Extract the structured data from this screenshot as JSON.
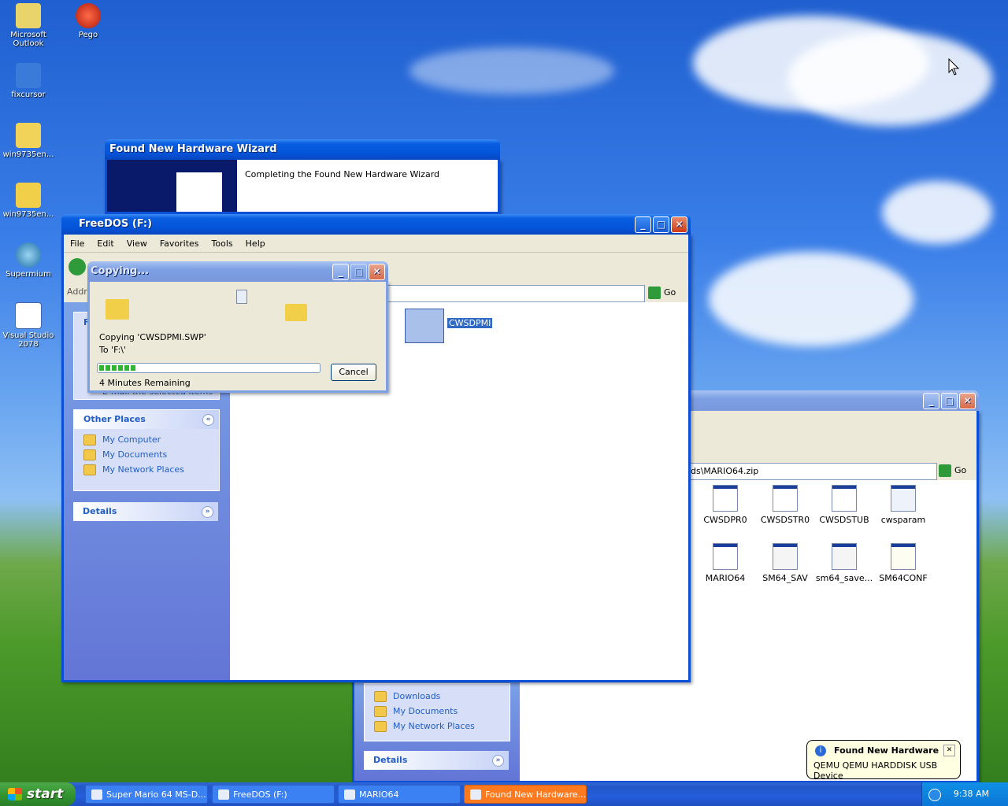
{
  "desktop": {
    "icons": [
      {
        "label": "Microsoft Outlook"
      },
      {
        "label": "Pego"
      },
      {
        "label": "fixcursor"
      },
      {
        "label": "win9735en..."
      },
      {
        "label": "win9735en..."
      },
      {
        "label": "Supermium"
      },
      {
        "label": "Visual Studio 2078"
      }
    ]
  },
  "wizard": {
    "title": "Found New Hardware Wizard",
    "heading": "Completing the Found New Hardware Wizard"
  },
  "freedos": {
    "title": "FreeDOS (F:)",
    "menu": [
      "File",
      "Edit",
      "View",
      "Favorites",
      "Tools",
      "Help"
    ],
    "address_label": "Addr",
    "go_label": "Go",
    "selected_file": "CWSDPMI",
    "hidden_task_text": "E-mail the selected items",
    "panel_task_label": "F",
    "other_places": {
      "title": "Other Places",
      "items": [
        "My Computer",
        "My Documents",
        "My Network Places"
      ]
    },
    "details_title": "Details"
  },
  "copying": {
    "title": "Copying...",
    "line1": "Copying 'CWSDPMI.SWP'",
    "line2": "To 'F:\\'",
    "remaining": "4 Minutes Remaining",
    "cancel_label": "Cancel",
    "progress": 0.17
  },
  "mario": {
    "address": "ds\\MARIO64.zip",
    "go_label": "Go",
    "files": [
      "CWSDPR0",
      "CWSDSTR0",
      "CWSDSTUB",
      "cwsparam",
      "MARIO64",
      "SM64_SAV",
      "sm64_save...",
      "SM64CONF"
    ],
    "other_places": [
      "Downloads",
      "My Documents",
      "My Network Places"
    ],
    "details_title": "Details"
  },
  "balloon": {
    "title": "Found New Hardware",
    "text": "QEMU QEMU HARDDISK USB Device"
  },
  "taskbar": {
    "start_label": "start",
    "tasks": [
      {
        "label": "Super Mario 64 MS-D..."
      },
      {
        "label": "FreeDOS (F:)"
      },
      {
        "label": "MARIO64"
      },
      {
        "label": "Found New Hardware..."
      }
    ],
    "clock": "9:38 AM"
  },
  "colors": {
    "xp_blue": "#0a4fd6",
    "task_link": "#215dc6",
    "active_task": "#ff7a1e"
  }
}
